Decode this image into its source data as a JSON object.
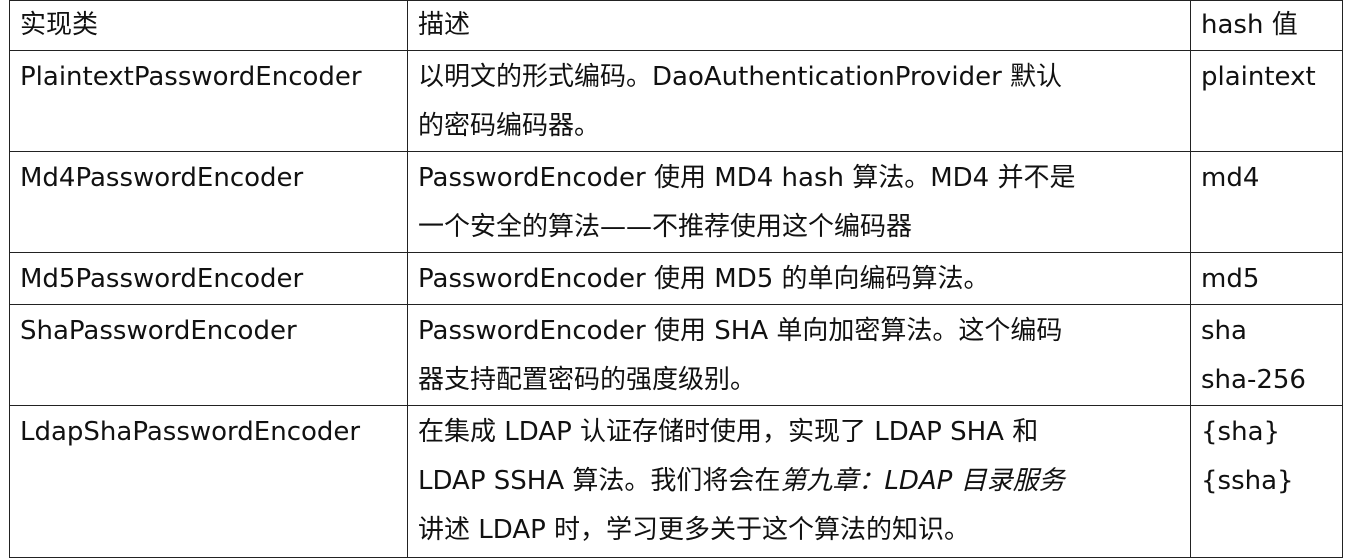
{
  "table": {
    "headers": {
      "impl": "实现类",
      "desc": "描述",
      "hash": "hash 值"
    },
    "rows": [
      {
        "impl": "PlaintextPasswordEncoder",
        "desc_line1": "以明文的形式编码。DaoAuthenticationProvider 默认",
        "desc_line2": "的密码编码器。",
        "hash": [
          "plaintext"
        ]
      },
      {
        "impl": "Md4PasswordEncoder",
        "desc_line1": "PasswordEncoder 使用 MD4  hash 算法。MD4 并不是",
        "desc_line2": "一个安全的算法——不推荐使用这个编码器",
        "hash": [
          "md4"
        ]
      },
      {
        "impl": "Md5PasswordEncoder",
        "desc_line1": "PasswordEncoder 使用 MD5 的单向编码算法。",
        "hash": [
          "md5"
        ]
      },
      {
        "impl": "ShaPasswordEncoder",
        "desc_line1": "PasswordEncoder 使用 SHA 单向加密算法。这个编码",
        "desc_line2": "器支持配置密码的强度级别。",
        "hash": [
          "sha",
          "sha-256"
        ]
      },
      {
        "impl": "LdapShaPasswordEncoder",
        "desc_line1": "在集成 LDAP 认证存储时使用，实现了 LDAP  SHA 和",
        "desc_line2_a": "LDAP SSHA 算法。我们将会在",
        "desc_line2_b": "第九章：LDAP 目录服务",
        "desc_line3": "讲述 LDAP 时，学习更多关于这个算法的知识。",
        "hash": [
          "{sha}",
          "{ssha}"
        ]
      }
    ]
  }
}
